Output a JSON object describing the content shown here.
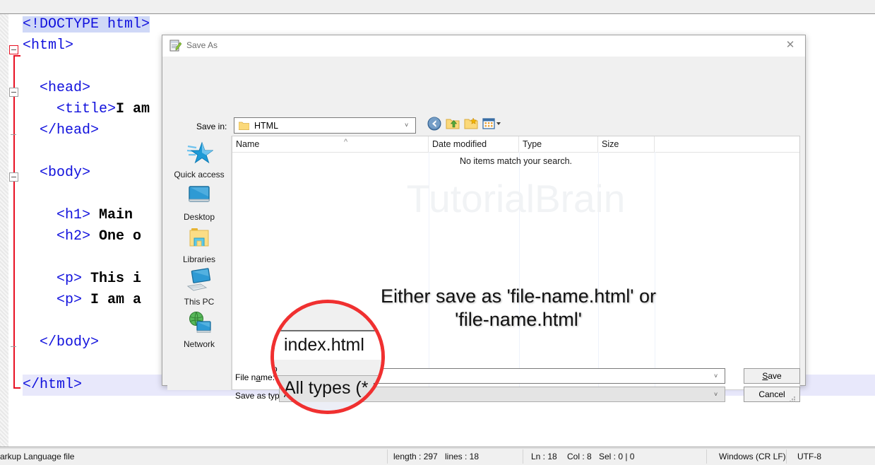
{
  "editor": {
    "code_lines": [
      {
        "indent": 0,
        "parts": [
          {
            "t": "<!DOCTYPE html>",
            "k": "tag-sel"
          }
        ]
      },
      {
        "indent": 0,
        "parts": [
          {
            "t": "<html>",
            "k": "tag"
          }
        ]
      },
      {
        "indent": 0,
        "parts": [
          {
            "t": "",
            "k": "tag"
          }
        ]
      },
      {
        "indent": 1,
        "parts": [
          {
            "t": "<head>",
            "k": "tag"
          }
        ]
      },
      {
        "indent": 2,
        "parts": [
          {
            "t": "<title>",
            "k": "tag"
          },
          {
            "t": "I am",
            "k": "txt"
          }
        ]
      },
      {
        "indent": 1,
        "parts": [
          {
            "t": "</head>",
            "k": "tag"
          }
        ]
      },
      {
        "indent": 0,
        "parts": [
          {
            "t": "",
            "k": "tag"
          }
        ]
      },
      {
        "indent": 1,
        "parts": [
          {
            "t": "<body>",
            "k": "tag"
          }
        ]
      },
      {
        "indent": 0,
        "parts": [
          {
            "t": "",
            "k": "tag"
          }
        ]
      },
      {
        "indent": 2,
        "parts": [
          {
            "t": "<h1>",
            "k": "tag"
          },
          {
            "t": " Main",
            "k": "txt"
          }
        ]
      },
      {
        "indent": 2,
        "parts": [
          {
            "t": "<h2>",
            "k": "tag"
          },
          {
            "t": " One o",
            "k": "txt"
          }
        ]
      },
      {
        "indent": 0,
        "parts": [
          {
            "t": "",
            "k": "tag"
          }
        ]
      },
      {
        "indent": 2,
        "parts": [
          {
            "t": "<p>",
            "k": "tag"
          },
          {
            "t": " This i",
            "k": "txt"
          }
        ]
      },
      {
        "indent": 2,
        "parts": [
          {
            "t": "<p>",
            "k": "tag"
          },
          {
            "t": " I am a",
            "k": "txt"
          }
        ]
      },
      {
        "indent": 0,
        "parts": [
          {
            "t": "",
            "k": "tag"
          }
        ]
      },
      {
        "indent": 1,
        "parts": [
          {
            "t": "</body>",
            "k": "tag"
          }
        ]
      },
      {
        "indent": 0,
        "parts": [
          {
            "t": "",
            "k": "tag"
          }
        ]
      },
      {
        "indent": 0,
        "parts": [
          {
            "t": "</html>",
            "k": "tag-hl"
          }
        ]
      }
    ]
  },
  "dialog": {
    "title": "Save As",
    "close_label": "✕",
    "save_in_label": "Save in:",
    "save_in_value": "HTML",
    "toolbar_icons": [
      "back-icon",
      "up-folder-icon",
      "new-folder-icon",
      "views-icon"
    ],
    "places": [
      {
        "label": "Quick access",
        "icon": "quick-access-star-icon"
      },
      {
        "label": "Desktop",
        "icon": "desktop-monitor-icon"
      },
      {
        "label": "Libraries",
        "icon": "libraries-folder-icon"
      },
      {
        "label": "This PC",
        "icon": "this-pc-icon"
      },
      {
        "label": "Network",
        "icon": "network-globe-icon"
      }
    ],
    "columns": [
      {
        "label": "Name"
      },
      {
        "label": "Date modified"
      },
      {
        "label": "Type"
      },
      {
        "label": "Size"
      }
    ],
    "empty_message": "No items match your search.",
    "watermark": "TutorialBrain",
    "callout": "Either save as 'file-name.html' or 'file-name.html'",
    "file_name_label": "File name:",
    "file_name_value": "index.html",
    "save_as_type_label": "Save as type:",
    "save_as_type_value": "All types (*.*)",
    "save_button": "Save",
    "cancel_button": "Cancel"
  },
  "magnifier": {
    "file_name_value": "index.html",
    "save_as_type_value": "All types (*.*)",
    "partial_label": "p",
    "circle_color": "#f03030"
  },
  "statusbar": {
    "file_type": "arkup Language file",
    "length": "length : 297",
    "lines": "lines : 18",
    "ln": "Ln : 18",
    "col": "Col : 8",
    "sel": "Sel : 0 | 0",
    "eol": "Windows (CR LF)",
    "encoding": "UTF-8"
  }
}
